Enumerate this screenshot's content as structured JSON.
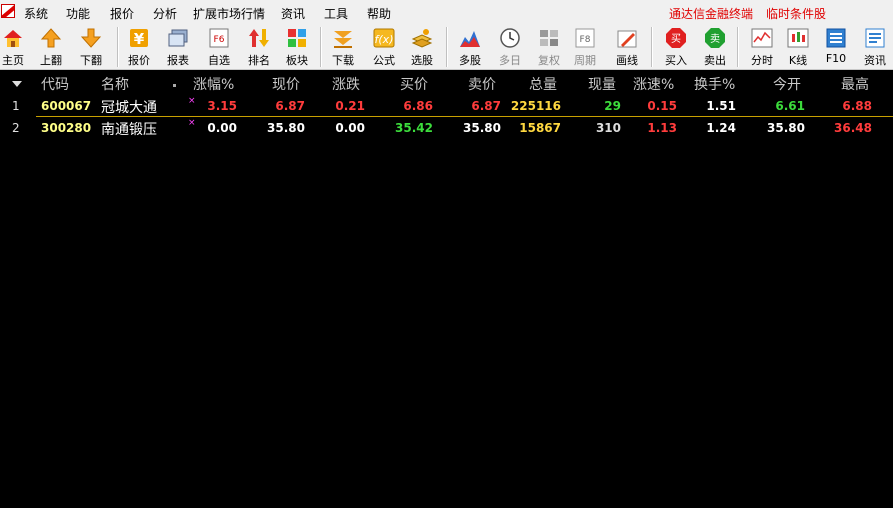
{
  "menubar": {
    "items": [
      "系统",
      "功能",
      "报价",
      "分析",
      "扩展市场行情",
      "资讯",
      "工具",
      "帮助"
    ],
    "right_links": [
      "通达信金融终端",
      "临时条件股"
    ]
  },
  "toolbar": {
    "buttons": [
      {
        "label": "主页",
        "icon": "home-icon"
      },
      {
        "label": "上翻",
        "icon": "arrow-up-icon"
      },
      {
        "label": "下翻",
        "icon": "arrow-down-icon"
      },
      {
        "label": "报价",
        "icon": "yuan-icon"
      },
      {
        "label": "报表",
        "icon": "report-icon"
      },
      {
        "label": "自选",
        "icon": "f6-icon"
      },
      {
        "label": "排名",
        "icon": "sort-icon"
      },
      {
        "label": "板块",
        "icon": "blocks-icon"
      },
      {
        "label": "下载",
        "icon": "download-icon"
      },
      {
        "label": "公式",
        "icon": "formula-icon"
      },
      {
        "label": "选股",
        "icon": "stock-pick-icon"
      },
      {
        "label": "多股",
        "icon": "multi-stock-icon"
      },
      {
        "label": "多日",
        "icon": "clock-icon"
      },
      {
        "label": "复权",
        "icon": "restore-icon"
      },
      {
        "label": "周期",
        "icon": "f8-icon"
      },
      {
        "label": "画线",
        "icon": "pencil-icon"
      },
      {
        "label": "买入",
        "icon": "buy-icon"
      },
      {
        "label": "卖出",
        "icon": "sell-icon"
      },
      {
        "label": "分时",
        "icon": "intraday-icon"
      },
      {
        "label": "K线",
        "icon": "kline-icon"
      },
      {
        "label": "F10",
        "icon": "f10-icon"
      },
      {
        "label": "资讯",
        "icon": "news-icon"
      }
    ]
  },
  "table": {
    "headers": [
      "代码",
      "名称",
      "涨幅%",
      "现价",
      "涨跌",
      "买价",
      "卖价",
      "总量",
      "现量",
      "涨速%",
      "换手%",
      "今开",
      "最高"
    ],
    "rows": [
      {
        "index": "1",
        "code": "600067",
        "name": "冠城大通",
        "mark": "×",
        "change_pct": "3.15",
        "price": "6.87",
        "change": "0.21",
        "bid": "6.86",
        "ask": "6.87",
        "volume": "225116",
        "cur_vol": "29",
        "speed": "0.15",
        "turnover": "1.51",
        "open": "6.61",
        "high": "6.88"
      },
      {
        "index": "2",
        "code": "300280",
        "name": "南通锻压",
        "mark": "×",
        "change_pct": "0.00",
        "price": "35.80",
        "change": "0.00",
        "bid": "35.42",
        "ask": "35.80",
        "volume": "15867",
        "cur_vol": "310",
        "speed": "1.13",
        "turnover": "1.24",
        "open": "35.80",
        "high": "36.48"
      }
    ]
  },
  "colors": {
    "up": "#ff3c3c",
    "down": "#3cdc3c",
    "flat": "#ffffff",
    "code": "#ffff88",
    "volume": "#ffd840",
    "selection_line": "#c8a000"
  }
}
